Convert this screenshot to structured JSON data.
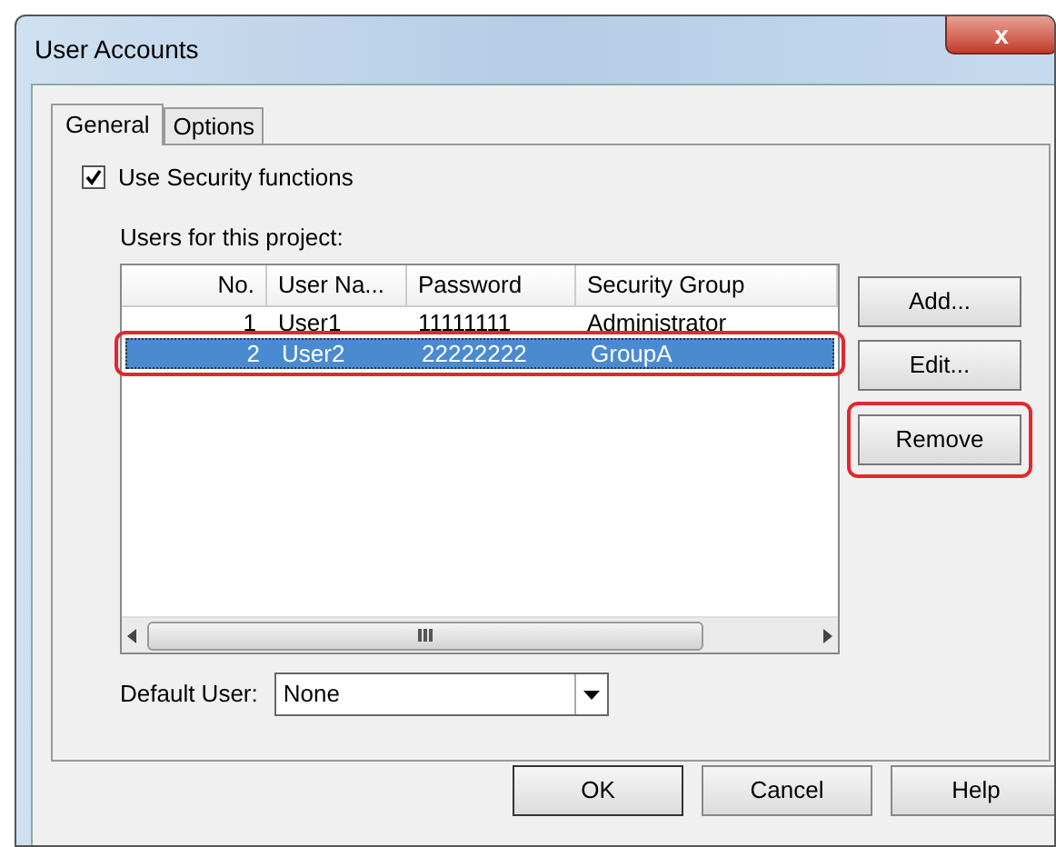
{
  "window": {
    "title": "User Accounts",
    "close_icon": "x"
  },
  "tabs": [
    {
      "label": "General",
      "selected": true
    },
    {
      "label": "Options",
      "selected": false
    }
  ],
  "use_security": {
    "label": "Use Security functions",
    "checked": true
  },
  "users_label": "Users for this project:",
  "table": {
    "columns": [
      "No.",
      "User Na...",
      "Password",
      "Security Group"
    ],
    "rows": [
      {
        "cells": [
          "1",
          "User1",
          "11111111",
          "Administrator"
        ],
        "selected": false,
        "highlighted": false
      },
      {
        "cells": [
          "2",
          "User2",
          "22222222",
          "GroupA"
        ],
        "selected": true,
        "highlighted": true
      }
    ]
  },
  "side_buttons": [
    {
      "label": "Add...",
      "highlighted": false
    },
    {
      "label": "Edit...",
      "highlighted": false
    },
    {
      "label": "Remove",
      "highlighted": true
    }
  ],
  "default_user": {
    "label": "Default User:",
    "value": "None"
  },
  "buttons": [
    "OK",
    "Cancel",
    "Help"
  ]
}
